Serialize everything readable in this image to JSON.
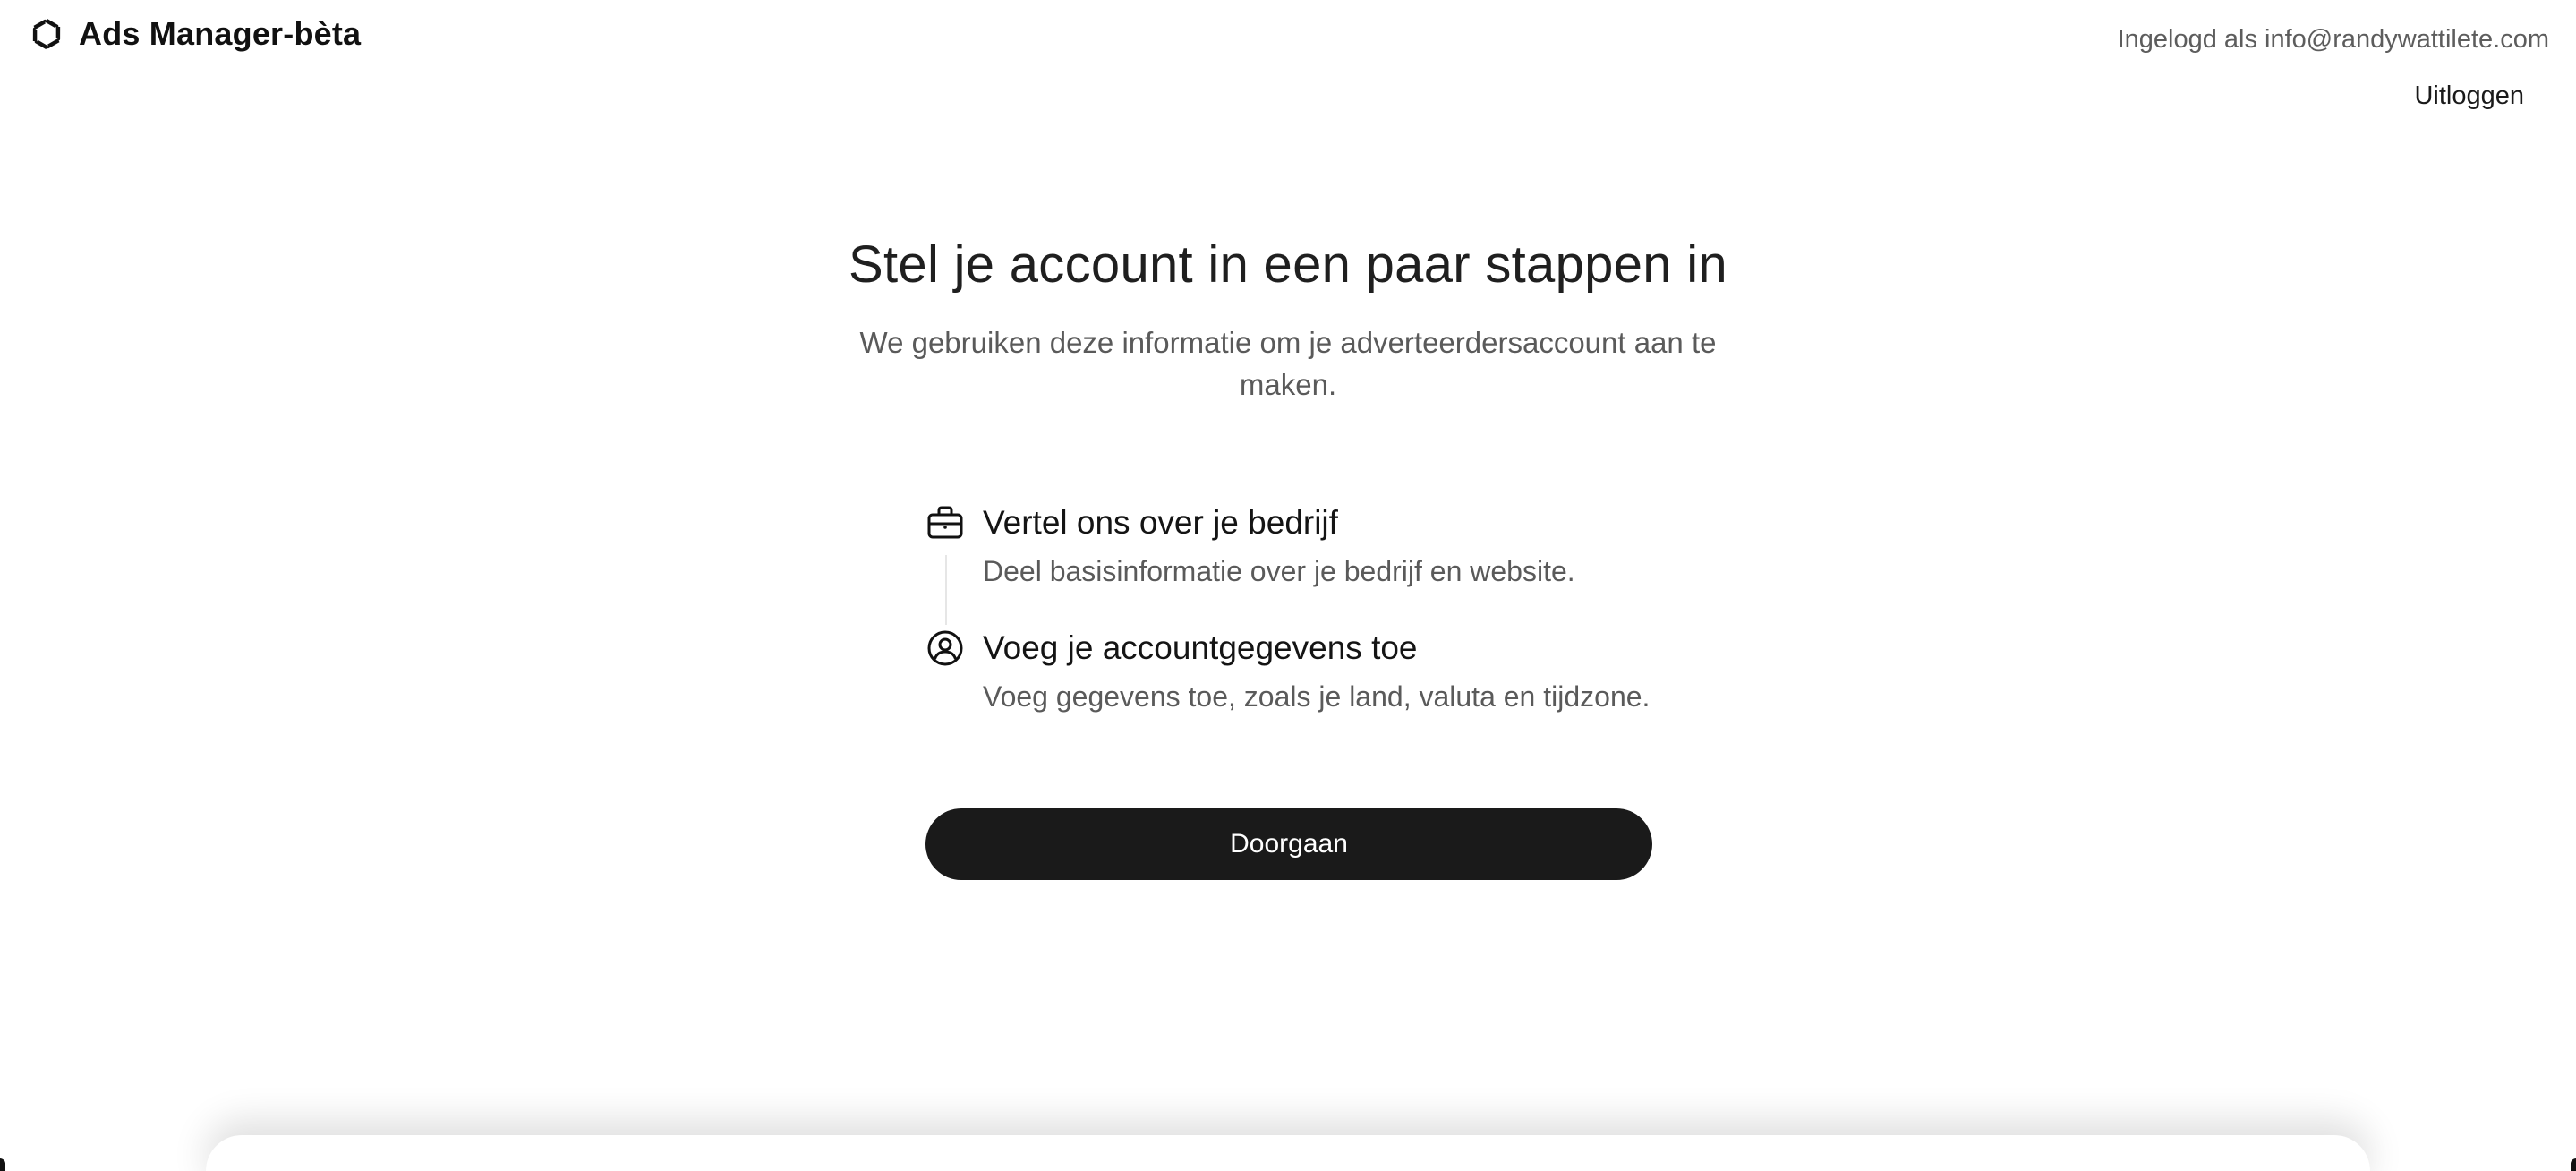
{
  "header": {
    "brand_title": "Ads Manager-bèta",
    "logged_in_text": "Ingelogd als info@randywattilete.com",
    "logout_label": "Uitloggen"
  },
  "main": {
    "heading": "Stel je account in een paar stappen in",
    "subheading": "We gebruiken deze informatie om je adverteerdersaccount aan te maken.",
    "steps": [
      {
        "icon": "briefcase-icon",
        "title": "Vertel ons over je bedrijf",
        "description": "Deel basisinformatie over je bedrijf en website."
      },
      {
        "icon": "user-circle-icon",
        "title": "Voeg je accountgegevens toe",
        "description": "Voeg gegevens toe, zoals je land, valuta en tijdzone."
      }
    ],
    "continue_label": "Doorgaan"
  },
  "colors": {
    "primary_button": "#1a1a1a",
    "primary_button_text": "#ffffff",
    "muted_text": "#5a5a5a"
  }
}
